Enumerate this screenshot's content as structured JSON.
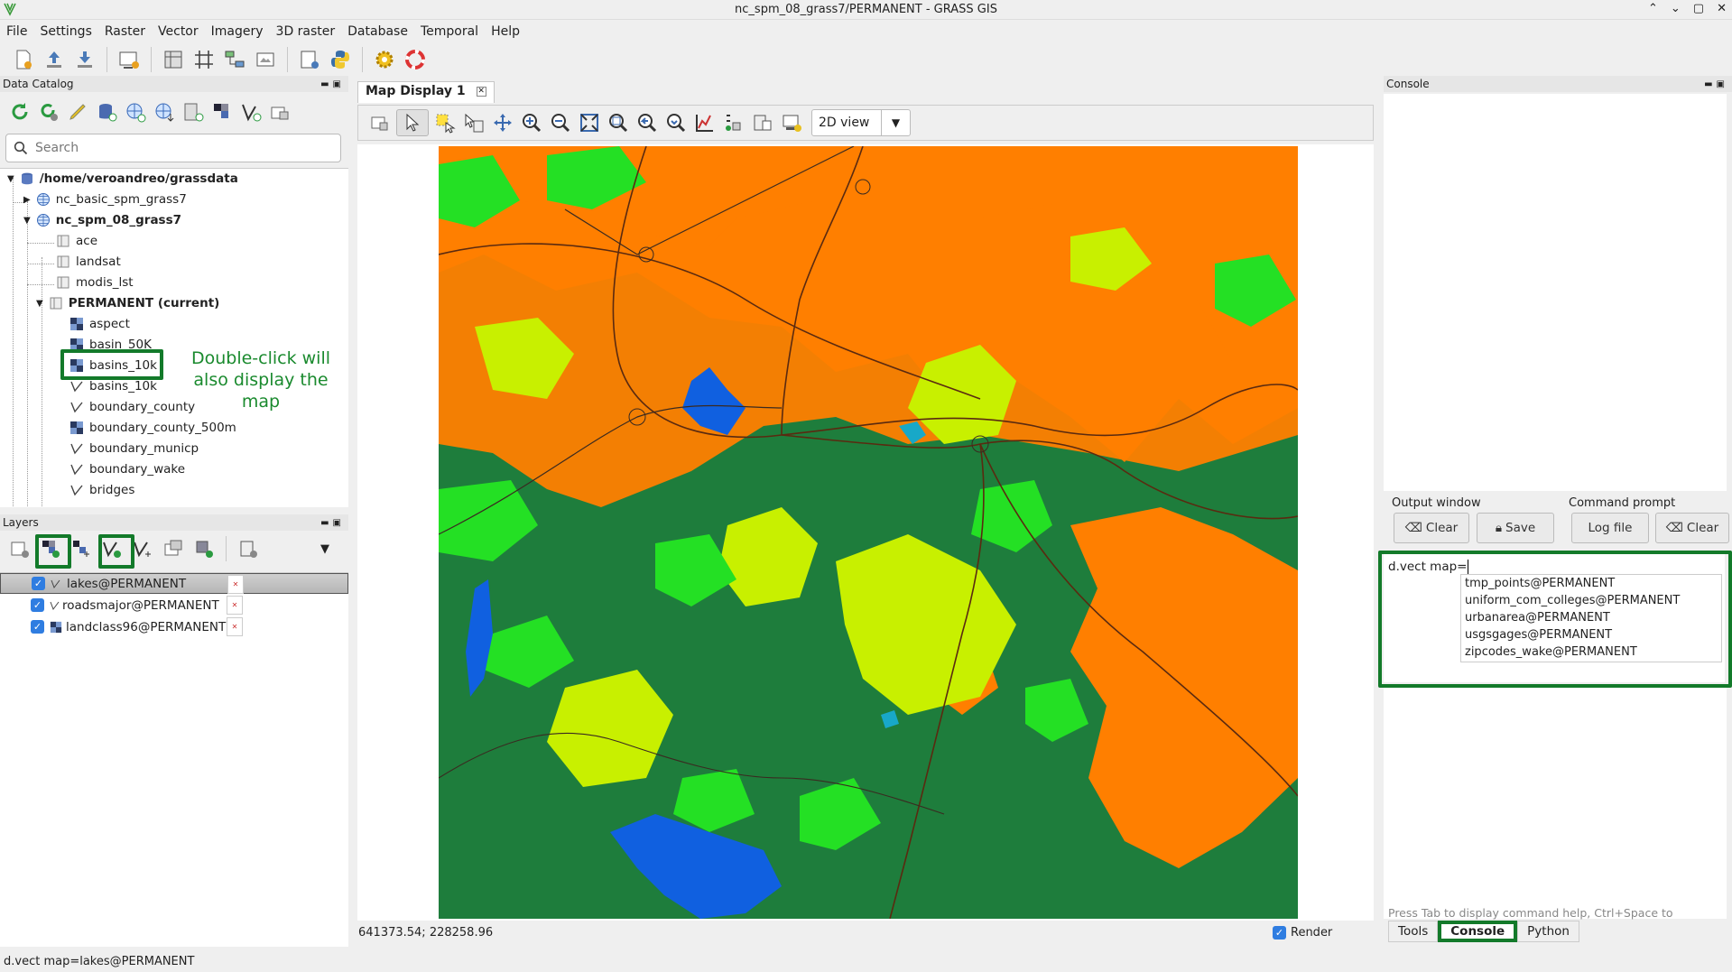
{
  "window": {
    "title": "nc_spm_08_grass7/PERMANENT - GRASS GIS",
    "controls": [
      "⌃",
      "⌄",
      "▢",
      "✕"
    ]
  },
  "menu": [
    "File",
    "Settings",
    "Raster",
    "Vector",
    "Imagery",
    "3D raster",
    "Database",
    "Temporal",
    "Help"
  ],
  "data_catalog": {
    "header": "Data Catalog",
    "search_placeholder": "Search",
    "tree": [
      {
        "label": "/home/veroandreo/grassdata",
        "bold": true
      },
      {
        "label": "nc_basic_spm_grass7"
      },
      {
        "label": "nc_spm_08_grass7",
        "bold": true
      },
      {
        "label": "ace"
      },
      {
        "label": "landsat"
      },
      {
        "label": "modis_lst"
      },
      {
        "label": "PERMANENT  (current)",
        "bold": true
      },
      {
        "label": "aspect"
      },
      {
        "label": "basin_50K"
      },
      {
        "label": "basins_10k"
      },
      {
        "label": "basins_10k"
      },
      {
        "label": "boundary_county"
      },
      {
        "label": "boundary_county_500m"
      },
      {
        "label": "boundary_municp"
      },
      {
        "label": "boundary_wake"
      },
      {
        "label": "bridges"
      }
    ],
    "annotation": "Double-click will also display the map"
  },
  "layers": {
    "header": "Layers",
    "items": [
      {
        "label": "lakes@PERMANENT",
        "selected": true
      },
      {
        "label": "roadsmajor@PERMANENT"
      },
      {
        "label": "landclass96@PERMANENT"
      }
    ]
  },
  "map_display": {
    "tab": "Map Display 1",
    "view_mode": "2D view",
    "coords": "641373.54; 228258.96",
    "render_label": "Render"
  },
  "console": {
    "header": "Console",
    "output_window": "Output window",
    "command_prompt": "Command prompt",
    "clear1": "Clear",
    "save": "Save",
    "logfile": "Log file",
    "clear2": "Clear",
    "command": "d.vect map=",
    "autocomplete": [
      "tmp_points@PERMANENT",
      "uniform_com_colleges@PERMANENT",
      "urbanarea@PERMANENT",
      "usgsgages@PERMANENT",
      "zipcodes_wake@PERMANENT"
    ],
    "hint": "Press Tab to display command help, Ctrl+Space to",
    "tabs": [
      "Tools",
      "Console",
      "Python"
    ]
  },
  "statusbar": "d.vect map=lakes@PERMANENT",
  "colors": {
    "forest": "#1e7d3c",
    "urban": "#ff7f00",
    "grass": "#24e024",
    "shrub": "#c8f000",
    "water": "#1060e0",
    "annotation_green": "#137a2a"
  }
}
